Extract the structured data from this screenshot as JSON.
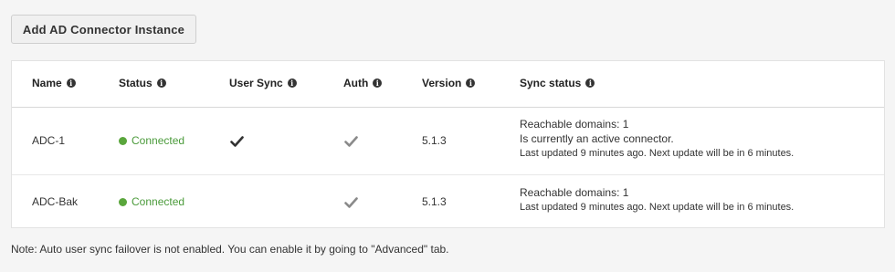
{
  "toolbar": {
    "add_button_label": "Add AD Connector Instance"
  },
  "table": {
    "headers": {
      "name": "Name",
      "status": "Status",
      "user_sync": "User Sync",
      "auth": "Auth",
      "version": "Version",
      "sync_status": "Sync status"
    },
    "rows": [
      {
        "name": "ADC-1",
        "status": "Connected",
        "user_sync": true,
        "auth": true,
        "version": "5.1.3",
        "sync_lines": [
          "Reachable domains: 1",
          "Is currently an active connector.",
          "Last updated 9 minutes ago. Next update will be in 6 minutes."
        ]
      },
      {
        "name": "ADC-Bak",
        "status": "Connected",
        "user_sync": false,
        "auth": true,
        "version": "5.1.3",
        "sync_lines": [
          "Reachable domains: 1",
          "Last updated 9 minutes ago. Next update will be in 6 minutes."
        ]
      }
    ]
  },
  "note": "Note: Auto user sync failover is not enabled. You can enable it by going to \"Advanced\" tab.",
  "colors": {
    "status_connected": "#5aa63c",
    "check_active": "#333333",
    "check_muted": "#8a8a8a"
  },
  "icons": {
    "info": "info-circle-icon",
    "check": "checkmark-icon",
    "status_dot": "status-dot-icon"
  }
}
